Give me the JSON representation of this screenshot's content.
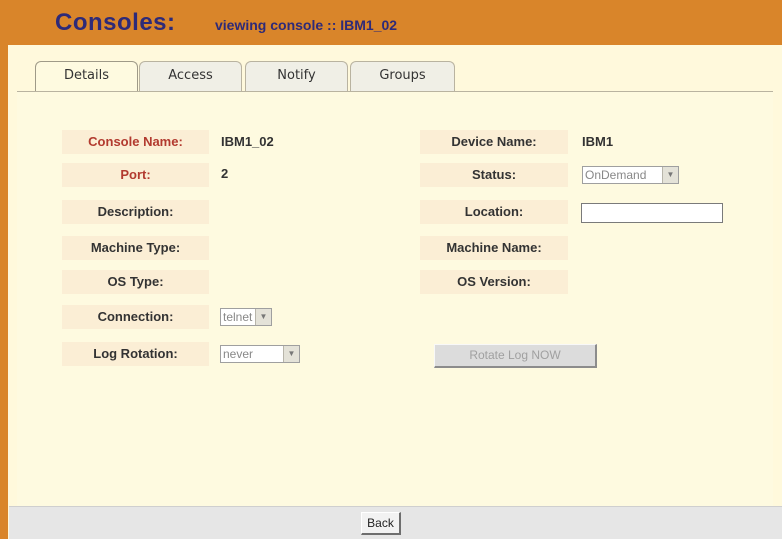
{
  "header": {
    "title": "Consoles:",
    "subtitle": "viewing console :: IBM1_02"
  },
  "tabs": [
    {
      "label": "Details",
      "active": true
    },
    {
      "label": "Access",
      "active": false
    },
    {
      "label": "Notify",
      "active": false
    },
    {
      "label": "Groups",
      "active": false
    }
  ],
  "fields": {
    "console_name": {
      "label": "Console Name:",
      "value": "IBM1_02"
    },
    "device_name": {
      "label": "Device Name:",
      "value": "IBM1"
    },
    "port": {
      "label": "Port:",
      "value": "2"
    },
    "status": {
      "label": "Status:",
      "value": "OnDemand"
    },
    "description": {
      "label": "Description:",
      "value": ""
    },
    "location": {
      "label": "Location:",
      "value": ""
    },
    "machine_type": {
      "label": "Machine Type:",
      "value": ""
    },
    "machine_name": {
      "label": "Machine Name:",
      "value": ""
    },
    "os_type": {
      "label": "OS Type:",
      "value": ""
    },
    "os_version": {
      "label": "OS Version:",
      "value": ""
    },
    "connection": {
      "label": "Connection:",
      "value": "telnet"
    },
    "log_rotation": {
      "label": "Log Rotation:",
      "value": "never"
    }
  },
  "buttons": {
    "rotate_log": "Rotate Log NOW",
    "back": "Back"
  },
  "colors": {
    "header_bg": "#d9852a",
    "title_text": "#2e2a78",
    "label_bg": "#fbeed5",
    "required_label": "#b23a2f",
    "panel_bg": "#fefae0"
  }
}
